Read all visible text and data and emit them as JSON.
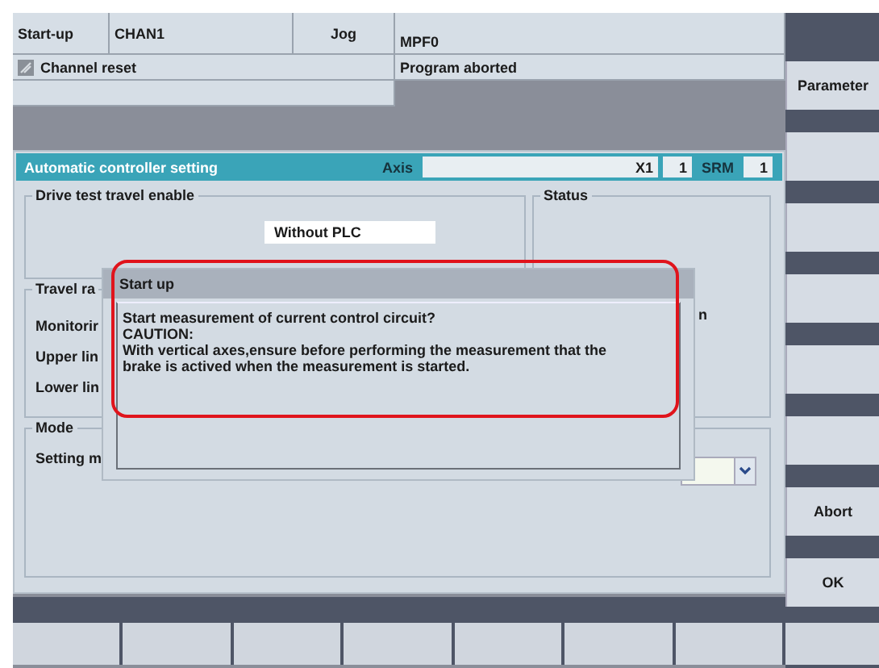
{
  "header": {
    "area": "Start-up",
    "channel": "CHAN1",
    "op_mode": "Jog",
    "program": "MPF0",
    "channel_status": "Channel reset",
    "program_status": "Program aborted"
  },
  "panel": {
    "title": "Automatic controller setting",
    "axis_label": "Axis",
    "axis_name": "X1",
    "axis_number": "1",
    "srm_label": "SRM",
    "srm_value": "1",
    "drive_group": {
      "title": "Drive test travel enable",
      "value": "Without PLC"
    },
    "status_group": {
      "title": "Status"
    },
    "travel_group": {
      "title": "Travel ra",
      "labels": [
        "Monitorir",
        "Upper lin",
        "Lower lin"
      ]
    },
    "mode_group": {
      "title": "Mode",
      "labels": [
        "Setting m"
      ]
    },
    "partial_text": "n"
  },
  "dialog": {
    "title": "Start up",
    "lines": [
      "Start measurement of current control circuit?",
      "CAUTION:",
      "With vertical axes,ensure before performing the measurement that the brake is actived when the measurement is started."
    ]
  },
  "softkeys_right": [
    {
      "kind": "label",
      "label": "Parameter"
    },
    {
      "kind": "blank"
    },
    {
      "kind": "blank"
    },
    {
      "kind": "blank"
    },
    {
      "kind": "blank"
    },
    {
      "kind": "blank"
    },
    {
      "kind": "label",
      "label": "Abort"
    },
    {
      "kind": "label",
      "label": "OK"
    }
  ],
  "softkeys_bottom": [
    {
      "kind": "blank"
    },
    {
      "kind": "blank"
    },
    {
      "kind": "blank"
    },
    {
      "kind": "blank"
    },
    {
      "kind": "blank"
    },
    {
      "kind": "blank"
    },
    {
      "kind": "blank"
    },
    {
      "kind": "blank"
    }
  ]
}
